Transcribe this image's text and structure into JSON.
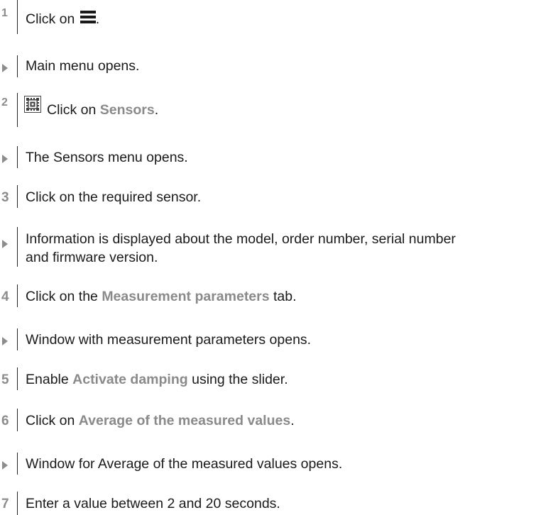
{
  "steps": [
    {
      "type": "step",
      "marker": "1",
      "before": "Click on ",
      "after": "."
    },
    {
      "type": "result",
      "text": "Main menu opens."
    },
    {
      "type": "step",
      "marker": "2",
      "before": "Click on ",
      "highlight": "Sensors",
      "after": "."
    },
    {
      "type": "result",
      "text": "The Sensors menu opens."
    },
    {
      "type": "step",
      "marker": "3",
      "text": "Click on the required sensor."
    },
    {
      "type": "result",
      "text_line1": "Information is displayed about the model, order number, serial number",
      "text_line2": "and firmware version."
    },
    {
      "type": "step",
      "marker": "4",
      "before": "Click on the ",
      "highlight": "Measurement parameters",
      "after": " tab."
    },
    {
      "type": "result",
      "text": "Window with measurement parameters opens."
    },
    {
      "type": "step",
      "marker": "5",
      "before": "Enable ",
      "highlight": "Activate damping",
      "after": " using the slider."
    },
    {
      "type": "step",
      "marker": "6",
      "before": "Click on ",
      "highlight": "Average of the measured values",
      "after": "."
    },
    {
      "type": "result",
      "text": "Window for Average of the measured values opens."
    },
    {
      "type": "step",
      "marker": "7",
      "text": "Enter a value between 2 and 20 seconds."
    }
  ],
  "icons": {
    "step1": "menu-icon",
    "step2": "sensor-chip-icon",
    "result": "triangle-arrow-icon"
  },
  "colors": {
    "marker": "#8c8c8c",
    "highlight": "#8a8a8a",
    "text": "#1a1a1a"
  }
}
